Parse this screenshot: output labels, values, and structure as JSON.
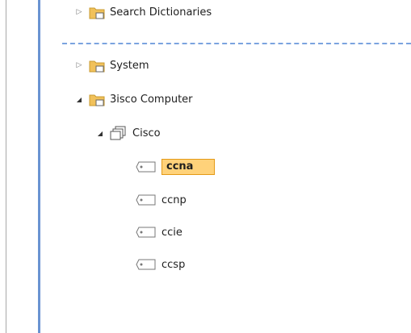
{
  "tree": {
    "search_dictionaries": "Search Dictionaries",
    "system": "System",
    "computer": "3isco Computer",
    "group": "Cisco",
    "items": [
      "ccna",
      "ccnp",
      "ccie",
      "ccsp"
    ],
    "selected_index": 0
  },
  "icons": {
    "expand_collapsed": "triangle-right-icon",
    "expand_open": "triangle-down-icon",
    "folder": "folder-icon",
    "group": "stack-icon",
    "item": "tag-icon"
  },
  "colors": {
    "selection_fill": "#ffd27a",
    "selection_border": "#e49a17",
    "separator": "#7ba3df",
    "accent_line": "#6a93d2"
  }
}
